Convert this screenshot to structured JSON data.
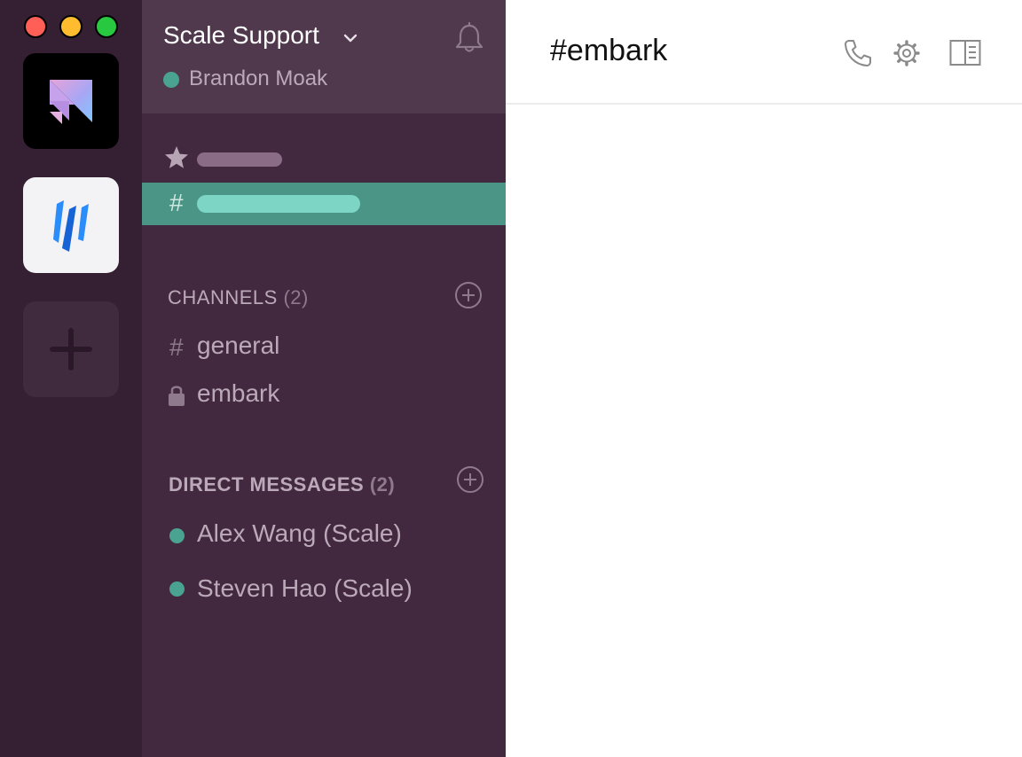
{
  "window": {
    "controls": [
      "close",
      "minimize",
      "zoom"
    ]
  },
  "workspaces": [
    {
      "name": "workspace-1",
      "icon": "gradient-logo-icon",
      "active": true
    },
    {
      "name": "workspace-2",
      "icon": "blue-stripes-logo-icon"
    },
    {
      "name": "add-workspace",
      "icon": "plus-icon"
    }
  ],
  "sidebar": {
    "team_name": "Scale Support",
    "user_name": "Brandon Moak",
    "user_status_color": "#4aa391",
    "starred_icon": "star-icon",
    "selected_hash": "#",
    "channels": {
      "title": "CHANNELS",
      "count": "(2)",
      "items": [
        {
          "prefix": "#",
          "label": "general",
          "private": false
        },
        {
          "prefix": "lock",
          "label": "embark",
          "private": true
        }
      ]
    },
    "direct_messages": {
      "title": "DIRECT MESSAGES",
      "count": "(2)",
      "items": [
        {
          "label": "Alex Wang (Scale)",
          "online": true
        },
        {
          "label": "Steven Hao (Scale)",
          "online": true
        }
      ]
    }
  },
  "main": {
    "channel_title": "#embark",
    "icons": [
      "phone-icon",
      "gear-icon",
      "details-panel-icon"
    ]
  },
  "colors": {
    "rail": "#341f33",
    "sidebar": "#43293f",
    "header": "#50384d",
    "selected": "#4a9585",
    "accent_teal": "#7dd5c6",
    "online": "#4aa391"
  }
}
